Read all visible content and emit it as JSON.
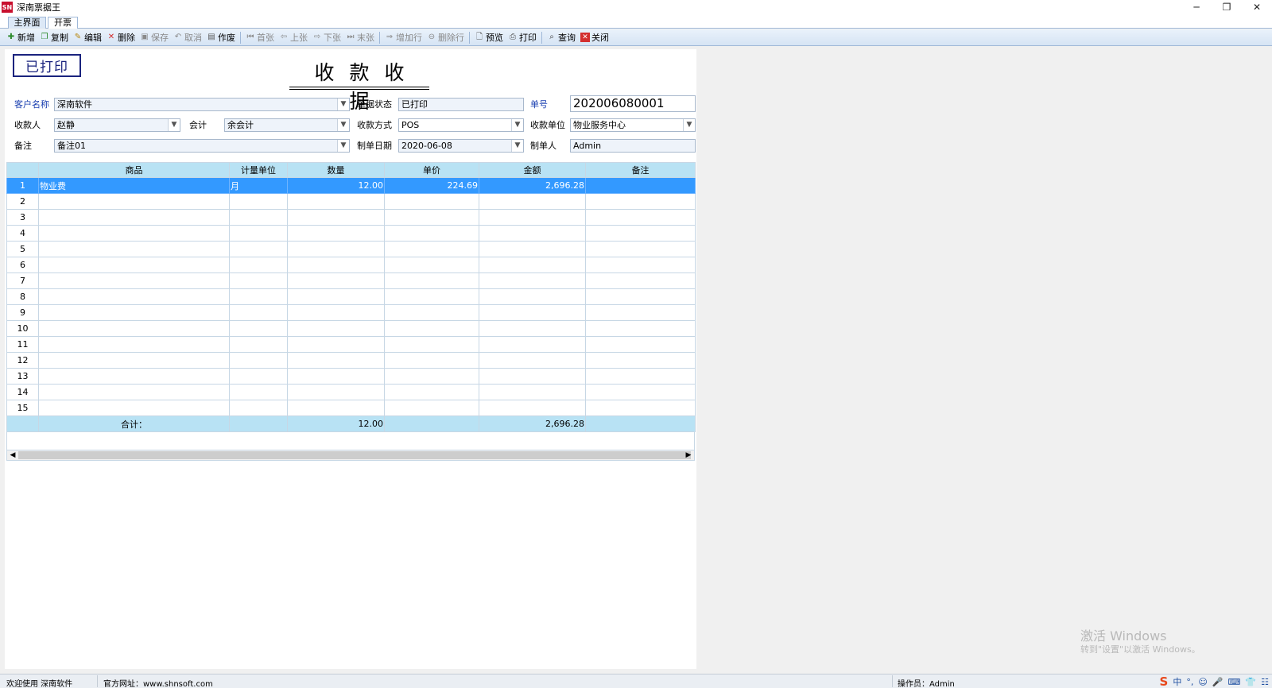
{
  "window": {
    "logo_text": "SN",
    "title": "深南票据王",
    "controls": [
      "─",
      "❐",
      "✕"
    ]
  },
  "tabs": [
    "主界面",
    "开票"
  ],
  "toolbar": {
    "new": "新增",
    "copy": "复制",
    "edit": "编辑",
    "delete": "删除",
    "save": "保存",
    "cancel": "取消",
    "void": "作废",
    "first": "首张",
    "prev": "上张",
    "next": "下张",
    "last": "末张",
    "add_row": "增加行",
    "del_row": "删除行",
    "preview": "预览",
    "print": "打印",
    "query": "查询",
    "close": "关闭"
  },
  "document": {
    "stamp": "已打印",
    "title": "收款收据"
  },
  "form": {
    "customer_label": "客户名称",
    "customer_value": "深南软件",
    "status_label": "单据状态",
    "status_value": "已打印",
    "number_label": "单号",
    "number_value": "202006080001",
    "payee_label": "收款人",
    "payee_value": "赵静",
    "account_label": "会计",
    "account_value": "余会计",
    "method_label": "收款方式",
    "method_value": "POS",
    "unit_label": "收款单位",
    "unit_value": "物业服务中心",
    "remark_label": "备注",
    "remark_value": "备注01",
    "date_label": "制单日期",
    "date_value": "2020-06-08",
    "maker_label": "制单人",
    "maker_value": "Admin"
  },
  "grid": {
    "headers": [
      "",
      "商品",
      "计量单位",
      "数量",
      "单价",
      "金额",
      "备注"
    ],
    "rows": [
      [
        "1",
        "物业费",
        "月",
        "12.00",
        "224.69",
        "2,696.28",
        ""
      ],
      [
        "2",
        "",
        "",
        "",
        "",
        "",
        ""
      ],
      [
        "3",
        "",
        "",
        "",
        "",
        "",
        ""
      ],
      [
        "4",
        "",
        "",
        "",
        "",
        "",
        ""
      ],
      [
        "5",
        "",
        "",
        "",
        "",
        "",
        ""
      ],
      [
        "6",
        "",
        "",
        "",
        "",
        "",
        ""
      ],
      [
        "7",
        "",
        "",
        "",
        "",
        "",
        ""
      ],
      [
        "8",
        "",
        "",
        "",
        "",
        "",
        ""
      ],
      [
        "9",
        "",
        "",
        "",
        "",
        "",
        ""
      ],
      [
        "10",
        "",
        "",
        "",
        "",
        "",
        ""
      ],
      [
        "11",
        "",
        "",
        "",
        "",
        "",
        ""
      ],
      [
        "12",
        "",
        "",
        "",
        "",
        "",
        ""
      ],
      [
        "13",
        "",
        "",
        "",
        "",
        "",
        ""
      ],
      [
        "14",
        "",
        "",
        "",
        "",
        "",
        ""
      ],
      [
        "15",
        "",
        "",
        "",
        "",
        "",
        ""
      ]
    ],
    "total": {
      "label": "合计：",
      "quantity": "12.00",
      "amount": "2,696.28"
    }
  },
  "watermark": {
    "line1": "激活 Windows",
    "line2": "转到\"设置\"以激活 Windows。"
  },
  "statusbar": {
    "welcome": "欢迎使用 深南软件",
    "website": "官方网址：www.shnsoft.com",
    "operator": "操作员：Admin",
    "tray_items": [
      "S",
      "中",
      "°,",
      "☺",
      "🎤",
      "⌨",
      "👕",
      "☷"
    ]
  },
  "colors": {
    "selected_row": "#3399ff",
    "header_bg": "#b8e2f4",
    "stamp": "#1a237e",
    "label_blue": "#1a3fb0"
  }
}
